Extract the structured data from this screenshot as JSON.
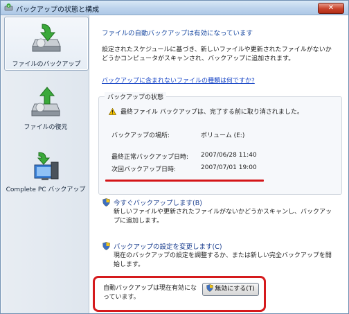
{
  "window": {
    "title": "バックアップの状態と構成",
    "close_label": "✕"
  },
  "sidebar": {
    "items": [
      {
        "label": "ファイルのバックアップ",
        "icon": "backup-drive-icon",
        "selected": true
      },
      {
        "label": "ファイルの復元",
        "icon": "restore-drive-icon",
        "selected": false
      },
      {
        "label": "Complete PC バックアップ",
        "icon": "pc-backup-icon",
        "selected": false
      }
    ]
  },
  "main": {
    "heading": "ファイルの自動バックアップは有効になっています",
    "description": "設定されたスケジュールに基づき、新しいファイルや更新されたファイルがないかどうかコンピュータがスキャンされ、バックアップに追加されます。",
    "help_link": "バックアップに含まれないファイルの種類は何ですか?",
    "status_group": {
      "title": "バックアップの状態",
      "warning": "最終ファイル バックアップは、完了する前に取り消されました。",
      "location_label": "バックアップの場所:",
      "location_value": "ボリューム (E:)",
      "last_label": "最終正常バックアップ日時:",
      "last_value": "2007/06/28 11:40",
      "next_label": "次回バックアップ日時:",
      "next_value": "2007/07/01 19:00"
    },
    "actions": [
      {
        "title": "今すぐバックアップします(B)",
        "description": "新しいファイルや更新されたファイルがないかどうかスキャンし、バックアップに追加します。"
      },
      {
        "title": "バックアップの設定を変更します(C)",
        "description": "現在のバックアップの設定を調整するか、または新しい完全バックアップを開始します。"
      }
    ],
    "auto_backup": {
      "status_text": "自動バックアップは現在有効になっています。",
      "button_label": "無効にする(T)"
    }
  },
  "colors": {
    "heading": "#1a4aa2",
    "link": "#1b48c7",
    "highlight": "#d51a1d"
  }
}
